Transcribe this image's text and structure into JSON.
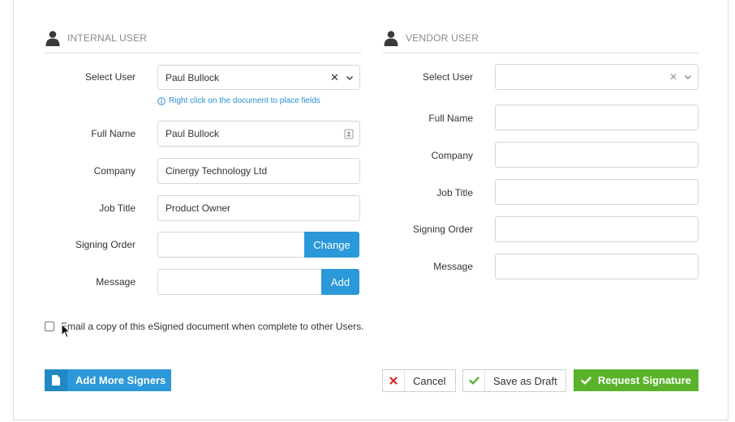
{
  "internal": {
    "title": "INTERNAL USER",
    "select_user_label": "Select User",
    "select_user_value": "Paul Bullock",
    "hint": "Right click on the document to place fields",
    "full_name_label": "Full Name",
    "full_name_value": "Paul Bullock",
    "company_label": "Company",
    "company_value": "Cinergy Technology Ltd",
    "job_title_label": "Job Title",
    "job_title_value": "Product Owner",
    "signing_order_label": "Signing Order",
    "signing_order_button": "Change",
    "message_label": "Message",
    "message_button": "Add"
  },
  "vendor": {
    "title": "VENDOR USER",
    "select_user_label": "Select User",
    "full_name_label": "Full Name",
    "company_label": "Company",
    "job_title_label": "Job Title",
    "signing_order_label": "Signing Order",
    "message_label": "Message"
  },
  "email_copy_label": "Email a copy of this eSigned document when complete to other Users.",
  "buttons": {
    "add_more_signers": "Add More Signers",
    "cancel": "Cancel",
    "save_draft": "Save as Draft",
    "request_signature": "Request Signature"
  },
  "colors": {
    "accent_blue": "#2b98d9",
    "green": "#59b22a",
    "cancel_red": "#e02424"
  }
}
